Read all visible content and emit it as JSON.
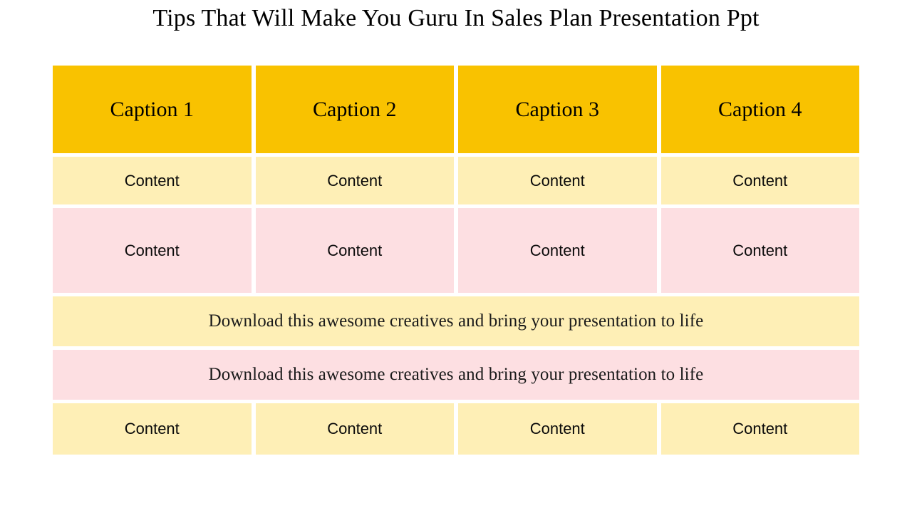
{
  "slide": {
    "title": "Tips That Will Make You Guru In Sales Plan Presentation Ppt",
    "background_color": "#FFFFFF"
  },
  "palette": {
    "caption_gold": "#F9C200",
    "pale_yellow": "#FEEFB6",
    "pale_pink": "#FDDFE2",
    "text_dark": "#000000"
  },
  "table": {
    "caption_row": {
      "cells": [
        {
          "label": "Caption 1"
        },
        {
          "label": "Caption 2"
        },
        {
          "label": "Caption 3"
        },
        {
          "label": "Caption 4"
        }
      ]
    },
    "content_row_1": {
      "fill": "#FEEFB6",
      "cells": [
        {
          "label": "Content"
        },
        {
          "label": "Content"
        },
        {
          "label": "Content"
        },
        {
          "label": "Content"
        }
      ]
    },
    "content_row_2": {
      "fill": "#FDDFE2",
      "cells": [
        {
          "label": "Content"
        },
        {
          "label": "Content"
        },
        {
          "label": "Content"
        },
        {
          "label": "Content"
        }
      ]
    },
    "banner_row_1": {
      "fill": "#FEEFB6",
      "text": "Download this awesome creatives and bring your presentation to life"
    },
    "banner_row_2": {
      "fill": "#FDDFE2",
      "text": "Download this awesome creatives and bring your presentation to life"
    },
    "content_row_3": {
      "fill": "#FEEFB6",
      "cells": [
        {
          "label": "Content"
        },
        {
          "label": "Content"
        },
        {
          "label": "Content"
        },
        {
          "label": "Content"
        }
      ]
    }
  }
}
